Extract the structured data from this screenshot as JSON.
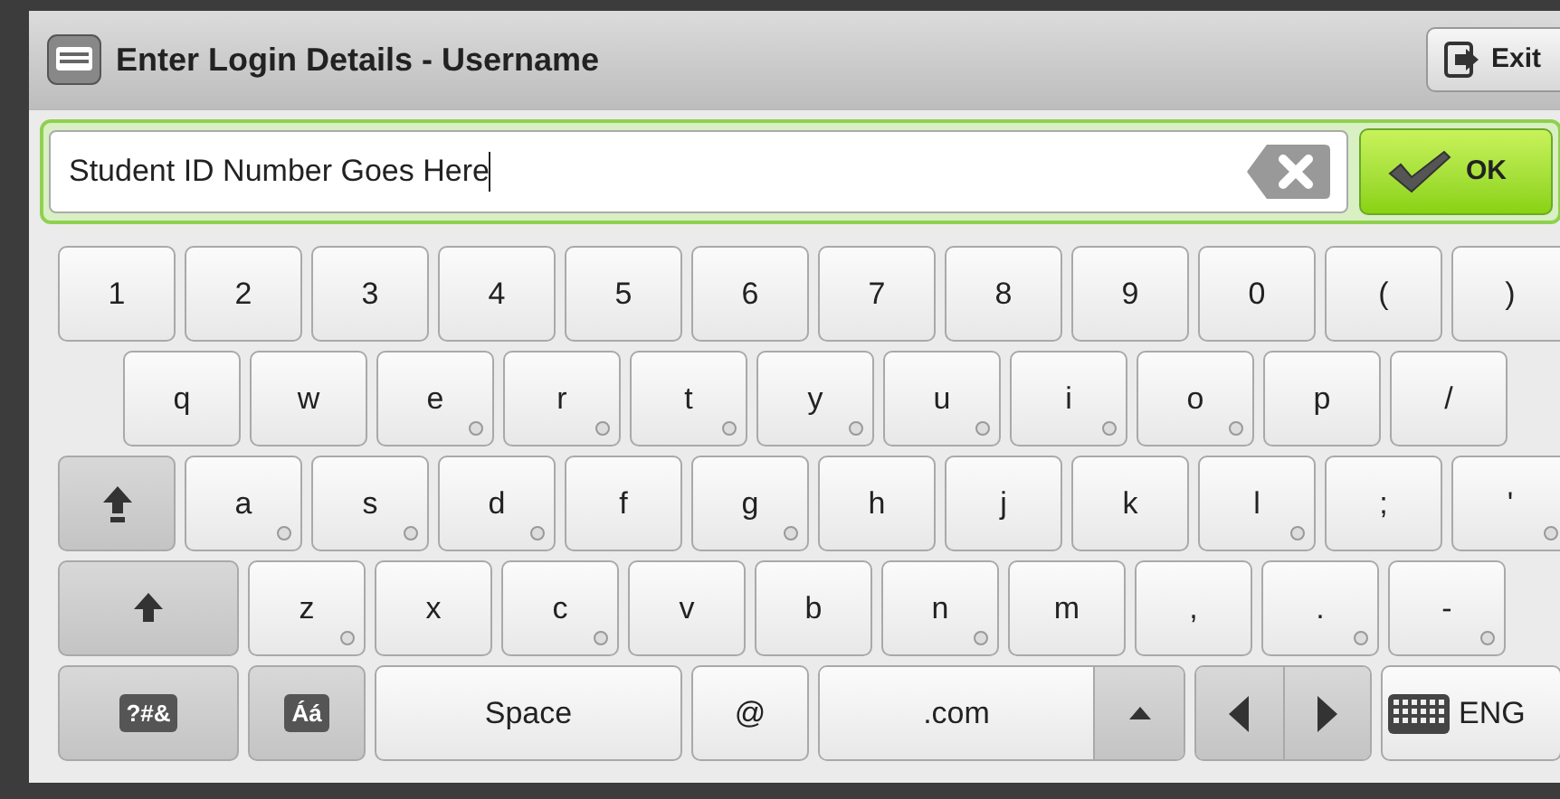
{
  "window": {
    "title": "Enter Login Details - Username"
  },
  "exit_button": "Exit",
  "input": {
    "value": "Student ID Number Goes Here"
  },
  "ok_button": "OK",
  "keyboard": {
    "rows": [
      {
        "indented": false,
        "keys": [
          {
            "kind": "char",
            "label": "1",
            "accent": false
          },
          {
            "kind": "char",
            "label": "2",
            "accent": false
          },
          {
            "kind": "char",
            "label": "3",
            "accent": false
          },
          {
            "kind": "char",
            "label": "4",
            "accent": false
          },
          {
            "kind": "char",
            "label": "5",
            "accent": false
          },
          {
            "kind": "char",
            "label": "6",
            "accent": false
          },
          {
            "kind": "char",
            "label": "7",
            "accent": false
          },
          {
            "kind": "char",
            "label": "8",
            "accent": false
          },
          {
            "kind": "char",
            "label": "9",
            "accent": false
          },
          {
            "kind": "char",
            "label": "0",
            "accent": false
          },
          {
            "kind": "char",
            "label": "(",
            "accent": false
          },
          {
            "kind": "char",
            "label": ")",
            "accent": false
          }
        ]
      },
      {
        "indented": true,
        "keys": [
          {
            "kind": "char",
            "label": "q",
            "accent": false
          },
          {
            "kind": "char",
            "label": "w",
            "accent": false
          },
          {
            "kind": "char",
            "label": "e",
            "accent": true
          },
          {
            "kind": "char",
            "label": "r",
            "accent": true
          },
          {
            "kind": "char",
            "label": "t",
            "accent": true
          },
          {
            "kind": "char",
            "label": "y",
            "accent": true
          },
          {
            "kind": "char",
            "label": "u",
            "accent": true
          },
          {
            "kind": "char",
            "label": "i",
            "accent": true
          },
          {
            "kind": "char",
            "label": "o",
            "accent": true
          },
          {
            "kind": "char",
            "label": "p",
            "accent": false
          },
          {
            "kind": "char",
            "label": "/",
            "accent": false
          }
        ]
      },
      {
        "indented": false,
        "keys": [
          {
            "kind": "caps"
          },
          {
            "kind": "char",
            "label": "a",
            "accent": true
          },
          {
            "kind": "char",
            "label": "s",
            "accent": true
          },
          {
            "kind": "char",
            "label": "d",
            "accent": true
          },
          {
            "kind": "char",
            "label": "f",
            "accent": false
          },
          {
            "kind": "char",
            "label": "g",
            "accent": true
          },
          {
            "kind": "char",
            "label": "h",
            "accent": false
          },
          {
            "kind": "char",
            "label": "j",
            "accent": false
          },
          {
            "kind": "char",
            "label": "k",
            "accent": false
          },
          {
            "kind": "char",
            "label": "l",
            "accent": true
          },
          {
            "kind": "char",
            "label": ";",
            "accent": false
          },
          {
            "kind": "char",
            "label": "'",
            "accent": true
          }
        ]
      },
      {
        "indented": false,
        "keys": [
          {
            "kind": "shift"
          },
          {
            "kind": "char",
            "label": "z",
            "accent": true
          },
          {
            "kind": "char",
            "label": "x",
            "accent": false
          },
          {
            "kind": "char",
            "label": "c",
            "accent": true
          },
          {
            "kind": "char",
            "label": "v",
            "accent": false
          },
          {
            "kind": "char",
            "label": "b",
            "accent": false
          },
          {
            "kind": "char",
            "label": "n",
            "accent": true
          },
          {
            "kind": "char",
            "label": "m",
            "accent": false
          },
          {
            "kind": "char",
            "label": ",",
            "accent": false
          },
          {
            "kind": "char",
            "label": ".",
            "accent": true
          },
          {
            "kind": "char",
            "label": "-",
            "accent": true
          }
        ]
      },
      {
        "indented": false,
        "keys": [
          {
            "kind": "symbols",
            "label": "?#&"
          },
          {
            "kind": "accents",
            "label": "Áá"
          },
          {
            "kind": "space",
            "label": "Space"
          },
          {
            "kind": "char",
            "label": "@",
            "accent": false
          },
          {
            "kind": "dotcom",
            "label": ".com"
          },
          {
            "kind": "cursor"
          },
          {
            "kind": "language",
            "label": "ENG"
          }
        ]
      }
    ]
  }
}
